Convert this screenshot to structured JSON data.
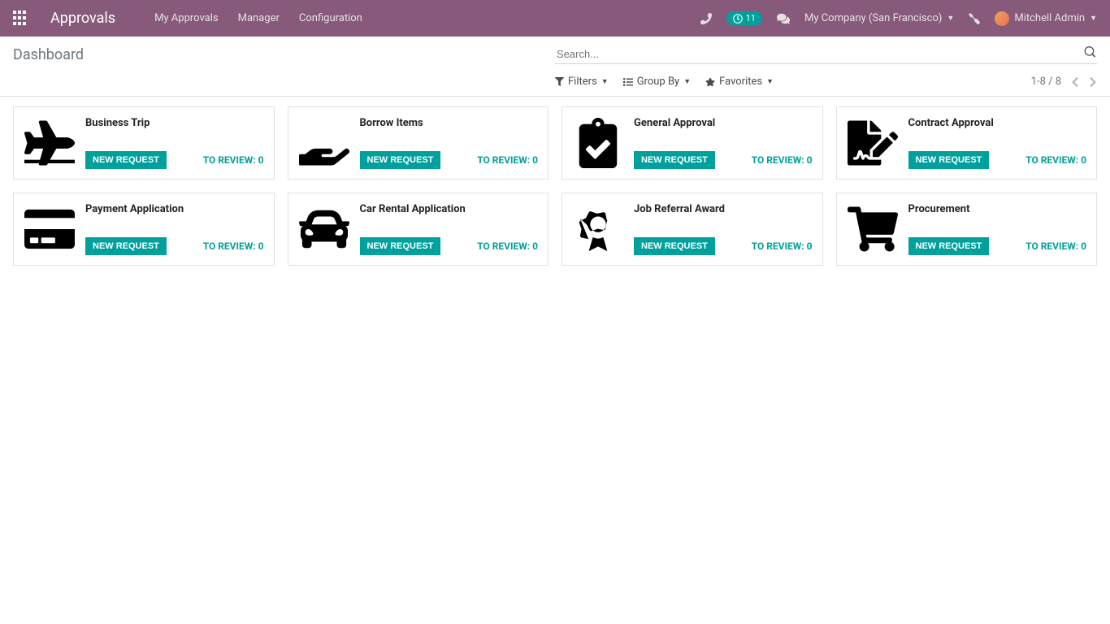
{
  "navbar": {
    "brand": "Approvals",
    "menu": [
      "My Approvals",
      "Manager",
      "Configuration"
    ],
    "activity_count": "11",
    "company": "My Company (San Francisco)",
    "user": "Mitchell Admin"
  },
  "control_panel": {
    "breadcrumb": "Dashboard",
    "search_placeholder": "Search...",
    "filters_label": "Filters",
    "groupby_label": "Group By",
    "favorites_label": "Favorites",
    "pager": "1-8 / 8"
  },
  "common": {
    "new_request_label": "New Request",
    "to_review_prefix": "TO REVIEW: "
  },
  "cards": [
    {
      "title": "Business Trip",
      "icon": "plane",
      "to_review": 0
    },
    {
      "title": "Borrow Items",
      "icon": "hand",
      "to_review": 0
    },
    {
      "title": "General Approval",
      "icon": "clipboard-check",
      "to_review": 0
    },
    {
      "title": "Contract Approval",
      "icon": "file-signature",
      "to_review": 0
    },
    {
      "title": "Payment Application",
      "icon": "credit-card",
      "to_review": 0
    },
    {
      "title": "Car Rental Application",
      "icon": "car",
      "to_review": 0
    },
    {
      "title": "Job Referral Award",
      "icon": "award",
      "to_review": 0
    },
    {
      "title": "Procurement",
      "icon": "cart",
      "to_review": 0
    }
  ]
}
